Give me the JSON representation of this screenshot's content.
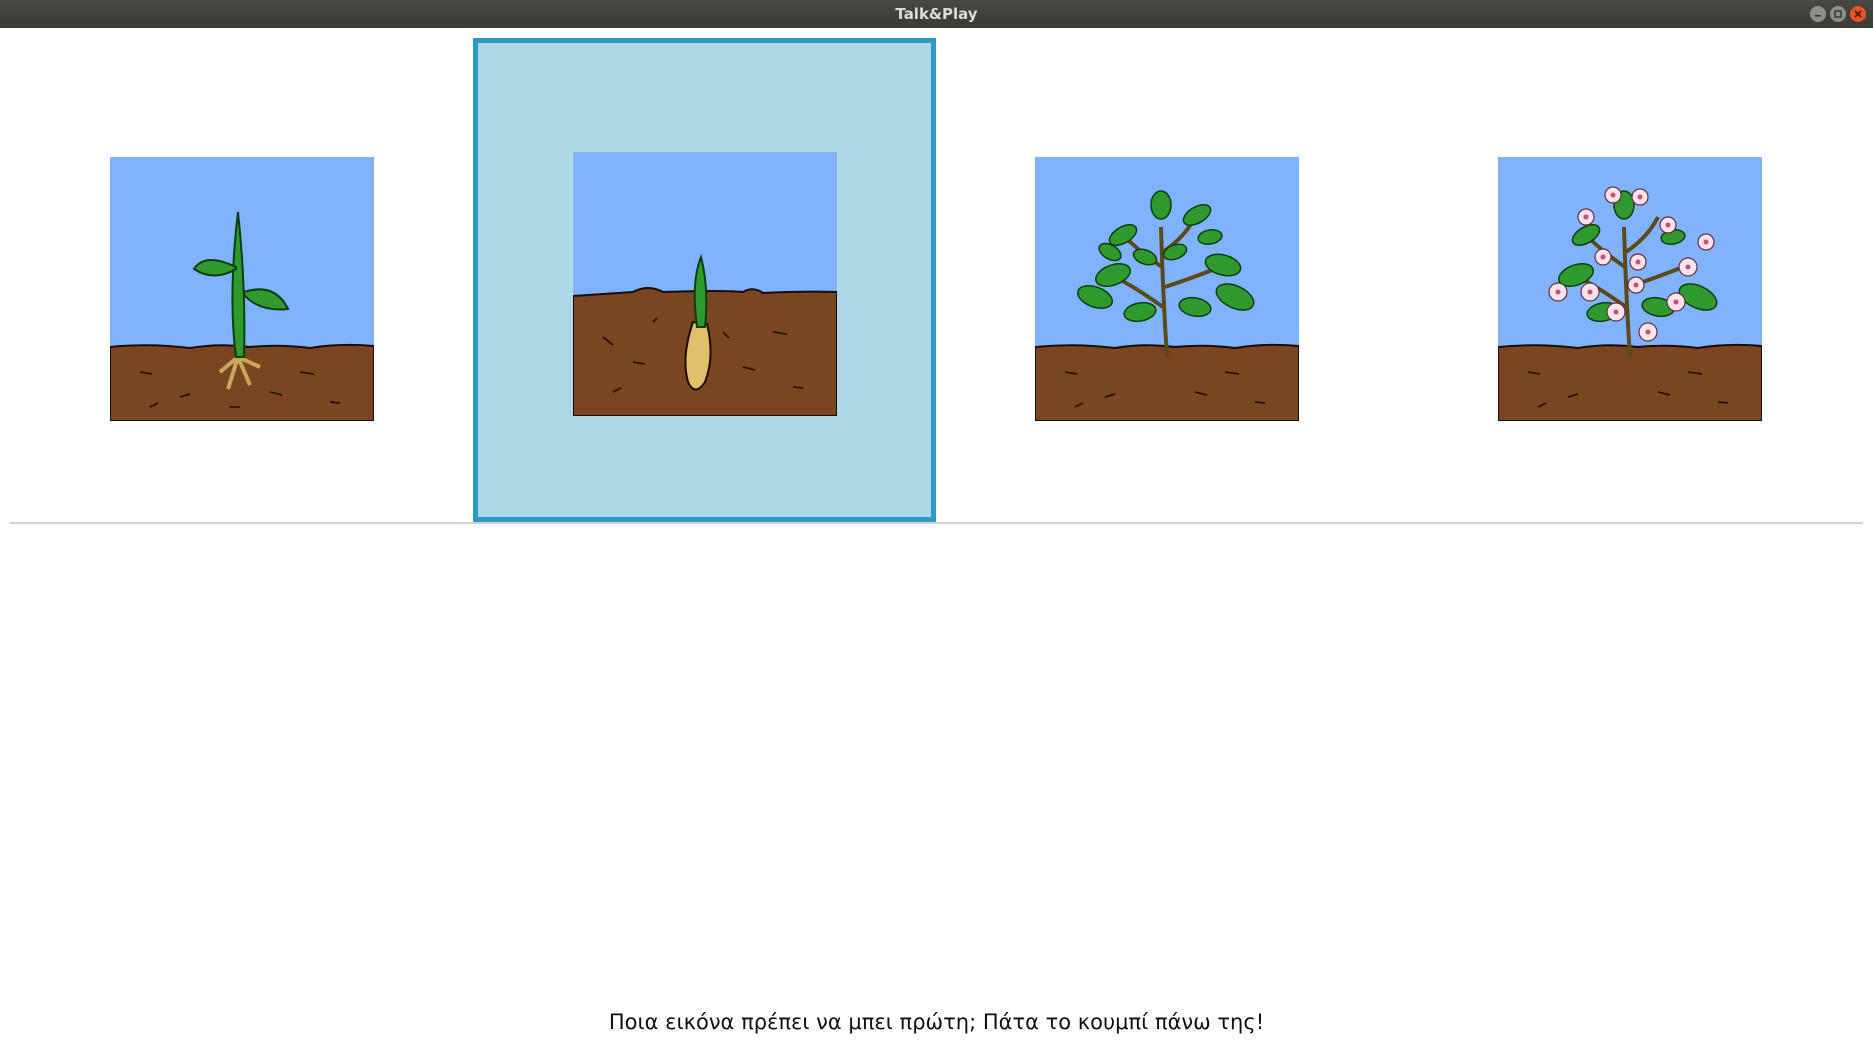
{
  "window": {
    "title": "Talk&Play"
  },
  "colors": {
    "selection_background": "#add8e6",
    "selection_border": "#2b9bc4",
    "sky": "#80b3ff",
    "soil": "#7a4520",
    "leaf": "#2e9a2e"
  },
  "cards": [
    {
      "icon": "sprout-with-leaves-icon",
      "selected": false
    },
    {
      "icon": "germinating-seed-icon",
      "selected": true
    },
    {
      "icon": "leafy-plant-icon",
      "selected": false
    },
    {
      "icon": "flowering-plant-icon",
      "selected": false
    }
  ],
  "instruction": "Ποια εικόνα πρέπει να μπει πρώτη; Πάτα το κουμπί πάνω της!"
}
